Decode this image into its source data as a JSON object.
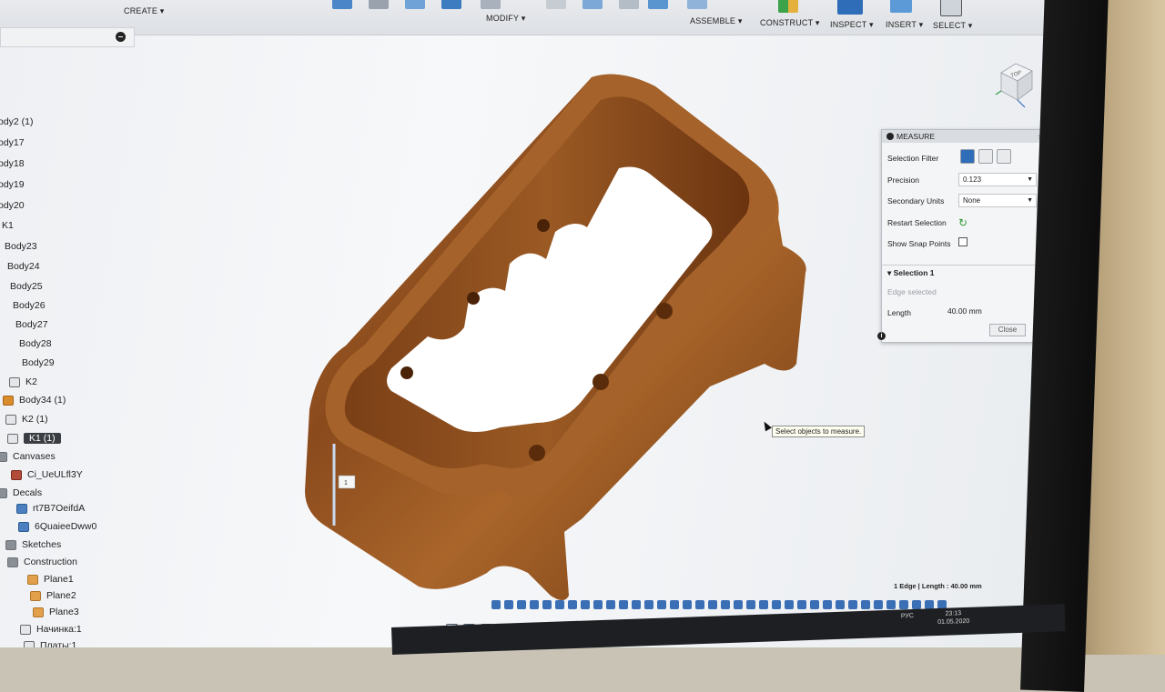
{
  "toolbar": {
    "create": "CREATE ▾",
    "modify": "MODIFY ▾",
    "assemble": "ASSEMBLE ▾",
    "construct": "CONSTRUCT ▾",
    "inspect": "INSPECT ▾",
    "insert": "INSERT ▾",
    "select": "SELECT ▾"
  },
  "browser": {
    "items": [
      {
        "label": "ody2 (1)",
        "icon": "body-icon"
      },
      {
        "label": "ody17",
        "icon": "body-icon"
      },
      {
        "label": "ody18",
        "icon": "body-icon"
      },
      {
        "label": "ody19",
        "icon": "body-icon"
      },
      {
        "label": "ody20",
        "icon": "body-icon"
      },
      {
        "label": "K1",
        "icon": "body-icon"
      },
      {
        "label": "Body23",
        "icon": "body-icon"
      },
      {
        "label": "Body24",
        "icon": "body-icon"
      },
      {
        "label": "Body25",
        "icon": "body-icon"
      },
      {
        "label": "Body26",
        "icon": "body-icon"
      },
      {
        "label": "Body27",
        "icon": "body-icon"
      },
      {
        "label": "Body28",
        "icon": "body-icon"
      },
      {
        "label": "Body29",
        "icon": "body-icon"
      },
      {
        "label": "K2",
        "icon": "body-icon"
      },
      {
        "label": "Body34 (1)",
        "icon": "body-icon"
      },
      {
        "label": "K2 (1)",
        "icon": "body-icon"
      },
      {
        "label": "K1 (1)",
        "icon": "body-icon"
      },
      {
        "label": "Canvases",
        "icon": "folder-icon"
      },
      {
        "label": "Ci_UeULfl3Y",
        "icon": "canvas-icon"
      },
      {
        "label": "Decals",
        "icon": "folder-icon"
      },
      {
        "label": "rt7B7OeifdA",
        "icon": "decal-icon"
      },
      {
        "label": "6QuaieeDww0",
        "icon": "decal-icon"
      },
      {
        "label": "Sketches",
        "icon": "folder-icon"
      },
      {
        "label": "Construction",
        "icon": "folder-icon"
      },
      {
        "label": "Plane1",
        "icon": "plane-icon"
      },
      {
        "label": "Plane2",
        "icon": "plane-icon"
      },
      {
        "label": "Plane3",
        "icon": "plane-icon"
      },
      {
        "label": "Начинка:1",
        "icon": "component-icon"
      },
      {
        "label": "Платы:1",
        "icon": "component-icon"
      }
    ]
  },
  "viewcube": {
    "face": "TOP"
  },
  "measure": {
    "title": "MEASURE",
    "selection_filter": "Selection Filter",
    "precision_label": "Precision",
    "precision_value": "0.123",
    "secondary_units_label": "Secondary Units",
    "secondary_units_value": "None",
    "restart_selection": "Restart Selection",
    "show_snap_points": "Show Snap Points",
    "selection_title": "Selection 1",
    "edge_selected": "Edge selected",
    "length_label": "Length",
    "length_value": "40.00 mm",
    "close": "Close"
  },
  "tooltip": "Select objects to measure.",
  "status": "1 Edge | Length : 40.00 mm",
  "taskbar": {
    "lang": "РУС",
    "time": "23:13",
    "date": "01.05.2020"
  },
  "model_marker": "1"
}
